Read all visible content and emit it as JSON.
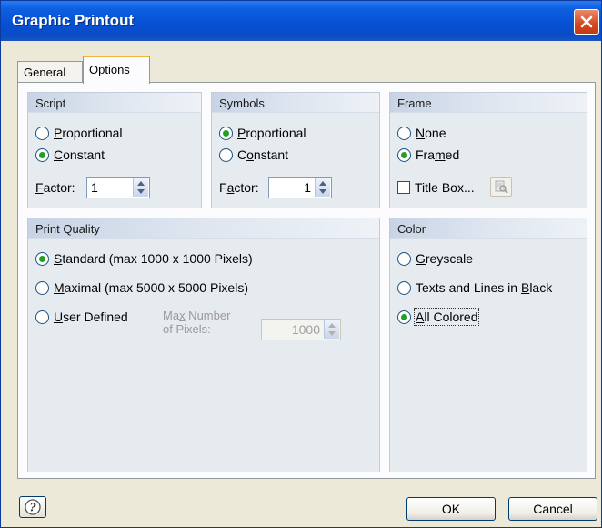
{
  "window": {
    "title": "Graphic Printout"
  },
  "tabs": [
    {
      "label": "General",
      "active": false
    },
    {
      "label": "Options",
      "active": true
    }
  ],
  "script": {
    "title": "Script",
    "options": [
      {
        "pre": "",
        "ul": "P",
        "post": "roportional",
        "checked": false
      },
      {
        "pre": "",
        "ul": "C",
        "post": "onstant",
        "checked": true
      }
    ],
    "factor_pre": "",
    "factor_ul": "F",
    "factor_post": "actor:",
    "factor_value": "1"
  },
  "symbols": {
    "title": "Symbols",
    "options": [
      {
        "pre": "",
        "ul": "P",
        "post": "roportional",
        "checked": true
      },
      {
        "pre": "C",
        "ul": "o",
        "post": "nstant",
        "checked": false
      }
    ],
    "factor_pre": "F",
    "factor_ul": "a",
    "factor_post": "ctor:",
    "factor_value": "1"
  },
  "frame": {
    "title": "Frame",
    "options": [
      {
        "pre": "",
        "ul": "N",
        "post": "one",
        "checked": false
      },
      {
        "pre": "Fra",
        "ul": "m",
        "post": "ed",
        "checked": true
      }
    ],
    "title_box_label": "Title Box...",
    "title_box_checked": false
  },
  "print_quality": {
    "title": "Print Quality",
    "options": [
      {
        "pre": "",
        "ul": "S",
        "post": "tandard (max 1000 x 1000 Pixels)",
        "checked": true
      },
      {
        "pre": "",
        "ul": "M",
        "post": "aximal (max 5000 x 5000 Pixels)",
        "checked": false
      },
      {
        "pre": "",
        "ul": "U",
        "post": "ser Defined",
        "checked": false
      }
    ],
    "max_label_pre": "Ma",
    "max_label_ul": "x",
    "max_label_post": " Number",
    "max_label_line2": "of Pixels:",
    "max_value": "1000"
  },
  "color": {
    "title": "Color",
    "options": [
      {
        "pre": "",
        "ul": "G",
        "post": "reyscale",
        "checked": false
      },
      {
        "pre": "Texts and Lines in ",
        "ul": "B",
        "post": "lack",
        "checked": false
      },
      {
        "pre": "",
        "ul": "A",
        "post": "ll Colored",
        "checked": true
      }
    ]
  },
  "footer": {
    "ok_label": "OK",
    "cancel_label": "Cancel"
  },
  "colors": {
    "titlebar": "#0651d6",
    "dialog_bg": "#ece9d8",
    "group_bg": "#e6ebf0",
    "radio_dot": "#21a121",
    "tab_accent": "#f1b43a"
  }
}
